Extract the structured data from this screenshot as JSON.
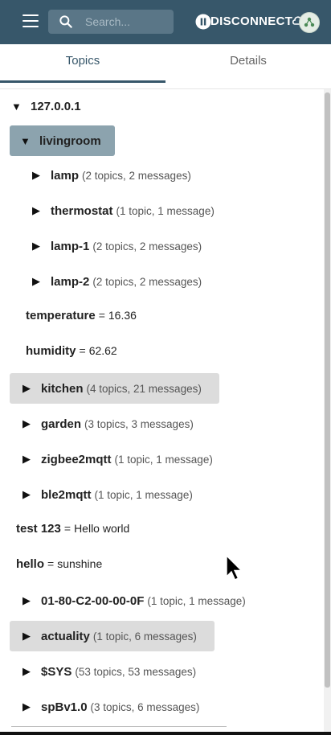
{
  "header": {
    "search_placeholder": "Search...",
    "disconnect_label": "DISCONNECT"
  },
  "tabs": [
    {
      "label": "Topics",
      "active": true
    },
    {
      "label": "Details",
      "active": false
    }
  ],
  "tree": {
    "root": "127.0.0.1",
    "livingroom": {
      "name": "livingroom",
      "children": [
        {
          "name": "lamp",
          "meta": "(2 topics, 2 messages)"
        },
        {
          "name": "thermostat",
          "meta": "(1 topic, 1 message)"
        },
        {
          "name": "lamp-1",
          "meta": "(2 topics, 2 messages)"
        },
        {
          "name": "lamp-2",
          "meta": "(2 topics, 2 messages)"
        }
      ],
      "values": [
        {
          "name": "temperature",
          "eq": "=",
          "value": "16.36"
        },
        {
          "name": "humidity",
          "eq": "=",
          "value": "62.62"
        }
      ]
    },
    "nodes": [
      {
        "name": "kitchen",
        "meta": "(4 topics, 21 messages)"
      },
      {
        "name": "garden",
        "meta": "(3 topics, 3 messages)"
      },
      {
        "name": "zigbee2mqtt",
        "meta": "(1 topic, 1 message)"
      },
      {
        "name": "ble2mqtt",
        "meta": "(1 topic, 1 message)"
      }
    ],
    "values": [
      {
        "name": "test 123",
        "eq": "=",
        "value": "Hello world"
      },
      {
        "name": "hello",
        "eq": "=",
        "value": "sunshine"
      }
    ],
    "nodes2": [
      {
        "name": "01-80-C2-00-00-0F",
        "meta": "(1 topic, 1 message)"
      },
      {
        "name": "actuality",
        "meta": "(1 topic, 6 messages)"
      },
      {
        "name": "$SYS",
        "meta": "(53 topics, 53 messages)"
      },
      {
        "name": "spBv1.0",
        "meta": "(3 topics, 6 messages)"
      }
    ]
  },
  "icons": {
    "collapsed": "▶",
    "expanded": "▼"
  },
  "colors": {
    "appbar": "#37576a",
    "selected": "#8ca3ae",
    "hover": "#dcdcdc"
  }
}
